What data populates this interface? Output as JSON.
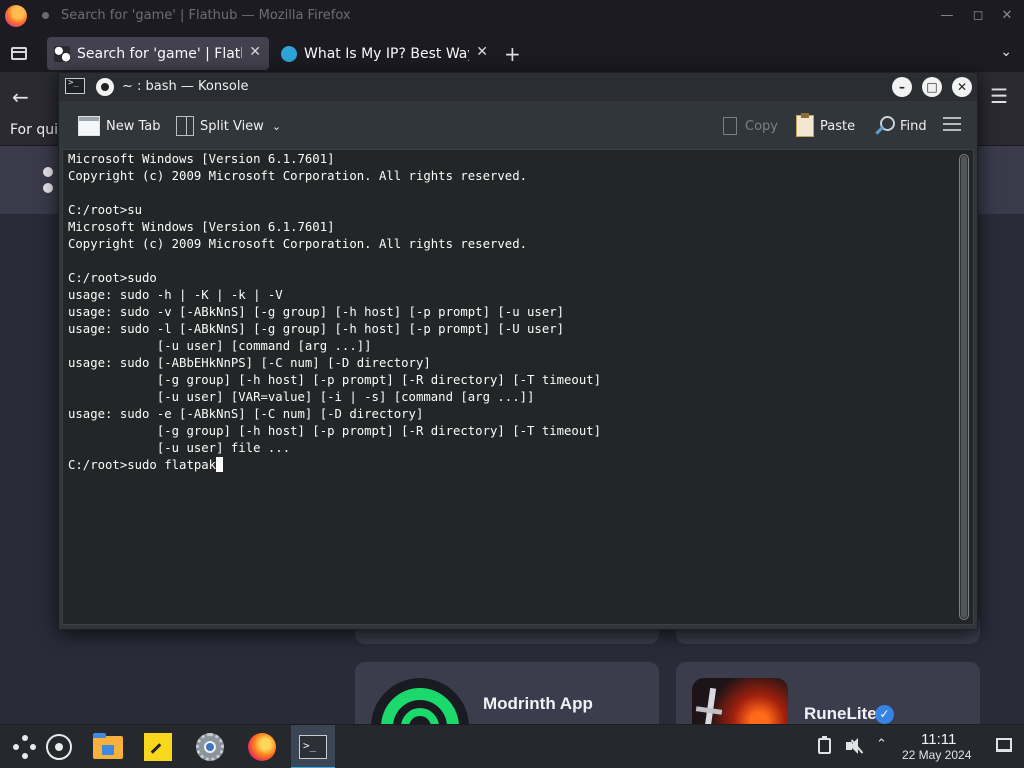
{
  "firefox": {
    "window_title": "Search for 'game' | Flathub — Mozilla Firefox",
    "tabs": [
      {
        "label": "Search for 'game' | Flathub",
        "active": true
      },
      {
        "label": "What Is My IP? Best Way",
        "active": false
      }
    ],
    "new_tab_symbol": "+",
    "quick_text": "For quic",
    "colors": {
      "toolbar": "#2b2a33",
      "titlebar": "#1c1b22"
    }
  },
  "flathub": {
    "apps": [
      {
        "name": "Modrinth App",
        "icon": "modrinth-icon"
      },
      {
        "name": "RuneLite",
        "icon": "runelite-icon",
        "verified": true
      }
    ],
    "colors": {
      "card": "#3b3c4c",
      "accent": "#3584e4"
    }
  },
  "konsole": {
    "title": "~ : bash — Konsole",
    "toolbar": {
      "new_tab": "New Tab",
      "split_view": "Split View",
      "copy": "Copy",
      "paste": "Paste",
      "find": "Find"
    },
    "terminal_lines": [
      "Microsoft Windows [Version 6.1.7601]",
      "Copyright (c) 2009 Microsoft Corporation. All rights reserved.",
      "",
      "C:/root>su",
      "Microsoft Windows [Version 6.1.7601]",
      "Copyright (c) 2009 Microsoft Corporation. All rights reserved.",
      "",
      "C:/root>sudo",
      "usage: sudo -h | -K | -k | -V",
      "usage: sudo -v [-ABkNnS] [-g group] [-h host] [-p prompt] [-u user]",
      "usage: sudo -l [-ABkNnS] [-g group] [-h host] [-p prompt] [-U user]",
      "            [-u user] [command [arg ...]]",
      "usage: sudo [-ABbEHkNnPS] [-C num] [-D directory]",
      "            [-g group] [-h host] [-p prompt] [-R directory] [-T timeout]",
      "            [-u user] [VAR=value] [-i | -s] [command [arg ...]]",
      "usage: sudo -e [-ABkNnS] [-C num] [-D directory]",
      "            [-g group] [-h host] [-p prompt] [-R directory] [-T timeout]",
      "            [-u user] file ..."
    ],
    "prompt_line": "C:/root>sudo flatpak",
    "colors": {
      "terminal_bg": "#232627",
      "text": "#fcfcfc",
      "chrome": "#31363b"
    }
  },
  "taskbar": {
    "items": [
      {
        "name": "application-launcher",
        "icon": "launcher-icon"
      },
      {
        "name": "steam",
        "icon": "steam-icon"
      },
      {
        "name": "files",
        "icon": "folder-icon"
      },
      {
        "name": "notes",
        "icon": "sticky-note-icon"
      },
      {
        "name": "system-settings",
        "icon": "settings-icon"
      },
      {
        "name": "firefox",
        "icon": "firefox-icon"
      },
      {
        "name": "konsole",
        "icon": "terminal-icon",
        "active": true
      }
    ],
    "clock": {
      "time": "11:11",
      "date": "22 May 2024"
    },
    "colors": {
      "panel": "#25282c",
      "active_highlight": "#3daee9"
    }
  }
}
